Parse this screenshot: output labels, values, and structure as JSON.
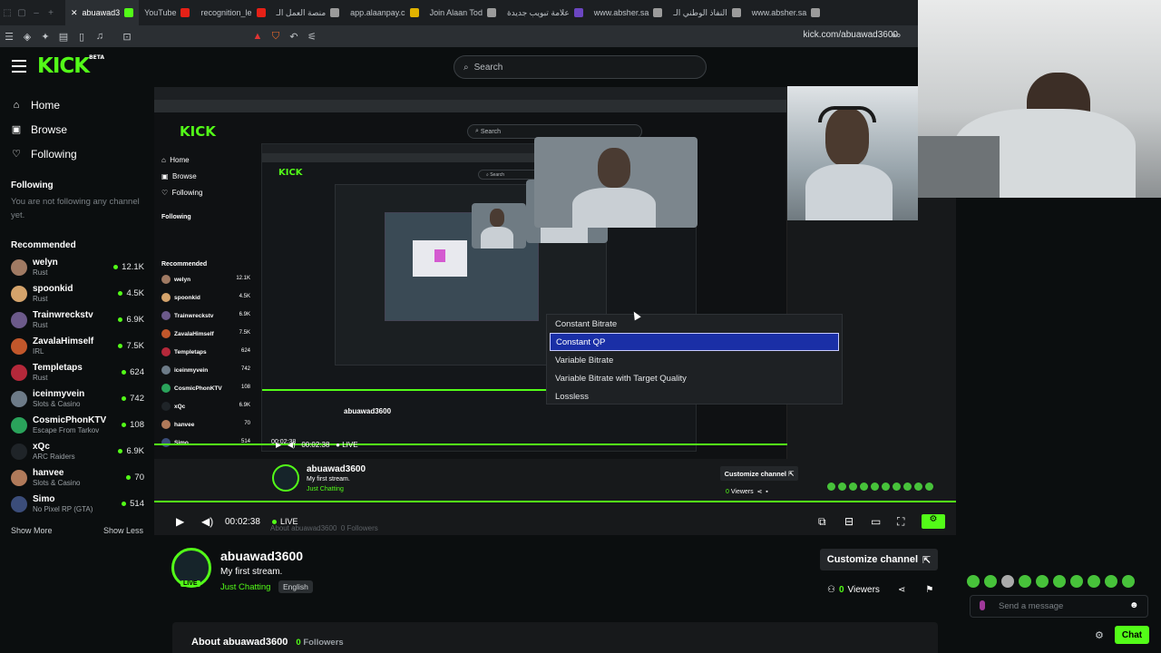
{
  "browser": {
    "tabs": [
      {
        "label": "abuawad3",
        "color": "#53fc18",
        "active": true
      },
      {
        "label": "YouTube",
        "color": "#e62117"
      },
      {
        "label": "recognition_le",
        "color": "#e62117"
      },
      {
        "label": "منصة العمل الـ",
        "color": "#9b9b9b"
      },
      {
        "label": "app.alaanpay.c",
        "color": "#e0b200"
      },
      {
        "label": "Join Alaan Tod",
        "color": "#9b9b9b"
      },
      {
        "label": "علامة تبويب جديدة",
        "color": "#6b46c1"
      },
      {
        "label": "www.absher.sa",
        "color": "#9b9b9b"
      },
      {
        "label": "النفاذ الوطني الـ",
        "color": "#9b9b9b"
      },
      {
        "label": "www.absher.sa",
        "color": "#9b9b9b"
      }
    ],
    "url": "kick.com/abuawad3600"
  },
  "header": {
    "logo": "KICK",
    "logo_badge": "BETA",
    "search_placeholder": "Search"
  },
  "sidebar": {
    "nav": [
      {
        "label": "Home",
        "icon": "home-icon"
      },
      {
        "label": "Browse",
        "icon": "browse-icon"
      },
      {
        "label": "Following",
        "icon": "heart-icon"
      }
    ],
    "following_heading": "Following",
    "following_empty": "You are not following any channel yet.",
    "recommended_heading": "Recommended",
    "recommended": [
      {
        "name": "welyn",
        "category": "Rust",
        "viewers": "12.1K",
        "color": "#a07a63"
      },
      {
        "name": "spoonkid",
        "category": "Rust",
        "viewers": "4.5K",
        "color": "#d4a36b"
      },
      {
        "name": "Trainwreckstv",
        "category": "Rust",
        "viewers": "6.9K",
        "color": "#6c5a8a"
      },
      {
        "name": "ZavalaHimself",
        "category": "IRL",
        "viewers": "7.5K",
        "color": "#c2572b"
      },
      {
        "name": "Templetaps",
        "category": "Rust",
        "viewers": "624",
        "color": "#b5283a"
      },
      {
        "name": "iceinmyvein",
        "category": "Slots & Casino",
        "viewers": "742",
        "color": "#6d7b88"
      },
      {
        "name": "CosmicPhonKTV",
        "category": "Escape From Tarkov",
        "viewers": "108",
        "color": "#2aa35b"
      },
      {
        "name": "xQc",
        "category": "ARC Raiders",
        "viewers": "6.9K",
        "color": "#1f2428"
      },
      {
        "name": "hanvee",
        "category": "Slots & Casino",
        "viewers": "70",
        "color": "#b07a5a"
      },
      {
        "name": "Simo",
        "category": "No Pixel RP (GTA)",
        "viewers": "514",
        "color": "#3b4d7a"
      }
    ],
    "show_more": "Show More",
    "show_less": "Show Less"
  },
  "dropdown": {
    "items": [
      "Constant Bitrate",
      "Constant QP",
      "Variable Bitrate",
      "Variable Bitrate with Target Quality",
      "Lossless"
    ],
    "selected": "Constant QP"
  },
  "player": {
    "time": "00:02:38",
    "live_label": "LIVE",
    "progress_fraction": 1.0
  },
  "channel": {
    "name": "abuawad3600",
    "title": "My first stream.",
    "category": "Just Chatting",
    "language": "English",
    "live_badge": "LIVE",
    "customize_label": "Customize channel",
    "viewers": "0",
    "viewers_label": "Viewers",
    "about_label": "About abuawad3600",
    "followers_count": "0",
    "followers_label": "Followers"
  },
  "chat": {
    "placeholder": "Send a message",
    "button": "Chat"
  },
  "nested": {
    "search": "Search",
    "about_text": "About abuawad3600",
    "followers": "0 Followers"
  },
  "colors": {
    "accent": "#53fc18",
    "background": "#0b0e0f",
    "selected": "#1a2fa6"
  }
}
